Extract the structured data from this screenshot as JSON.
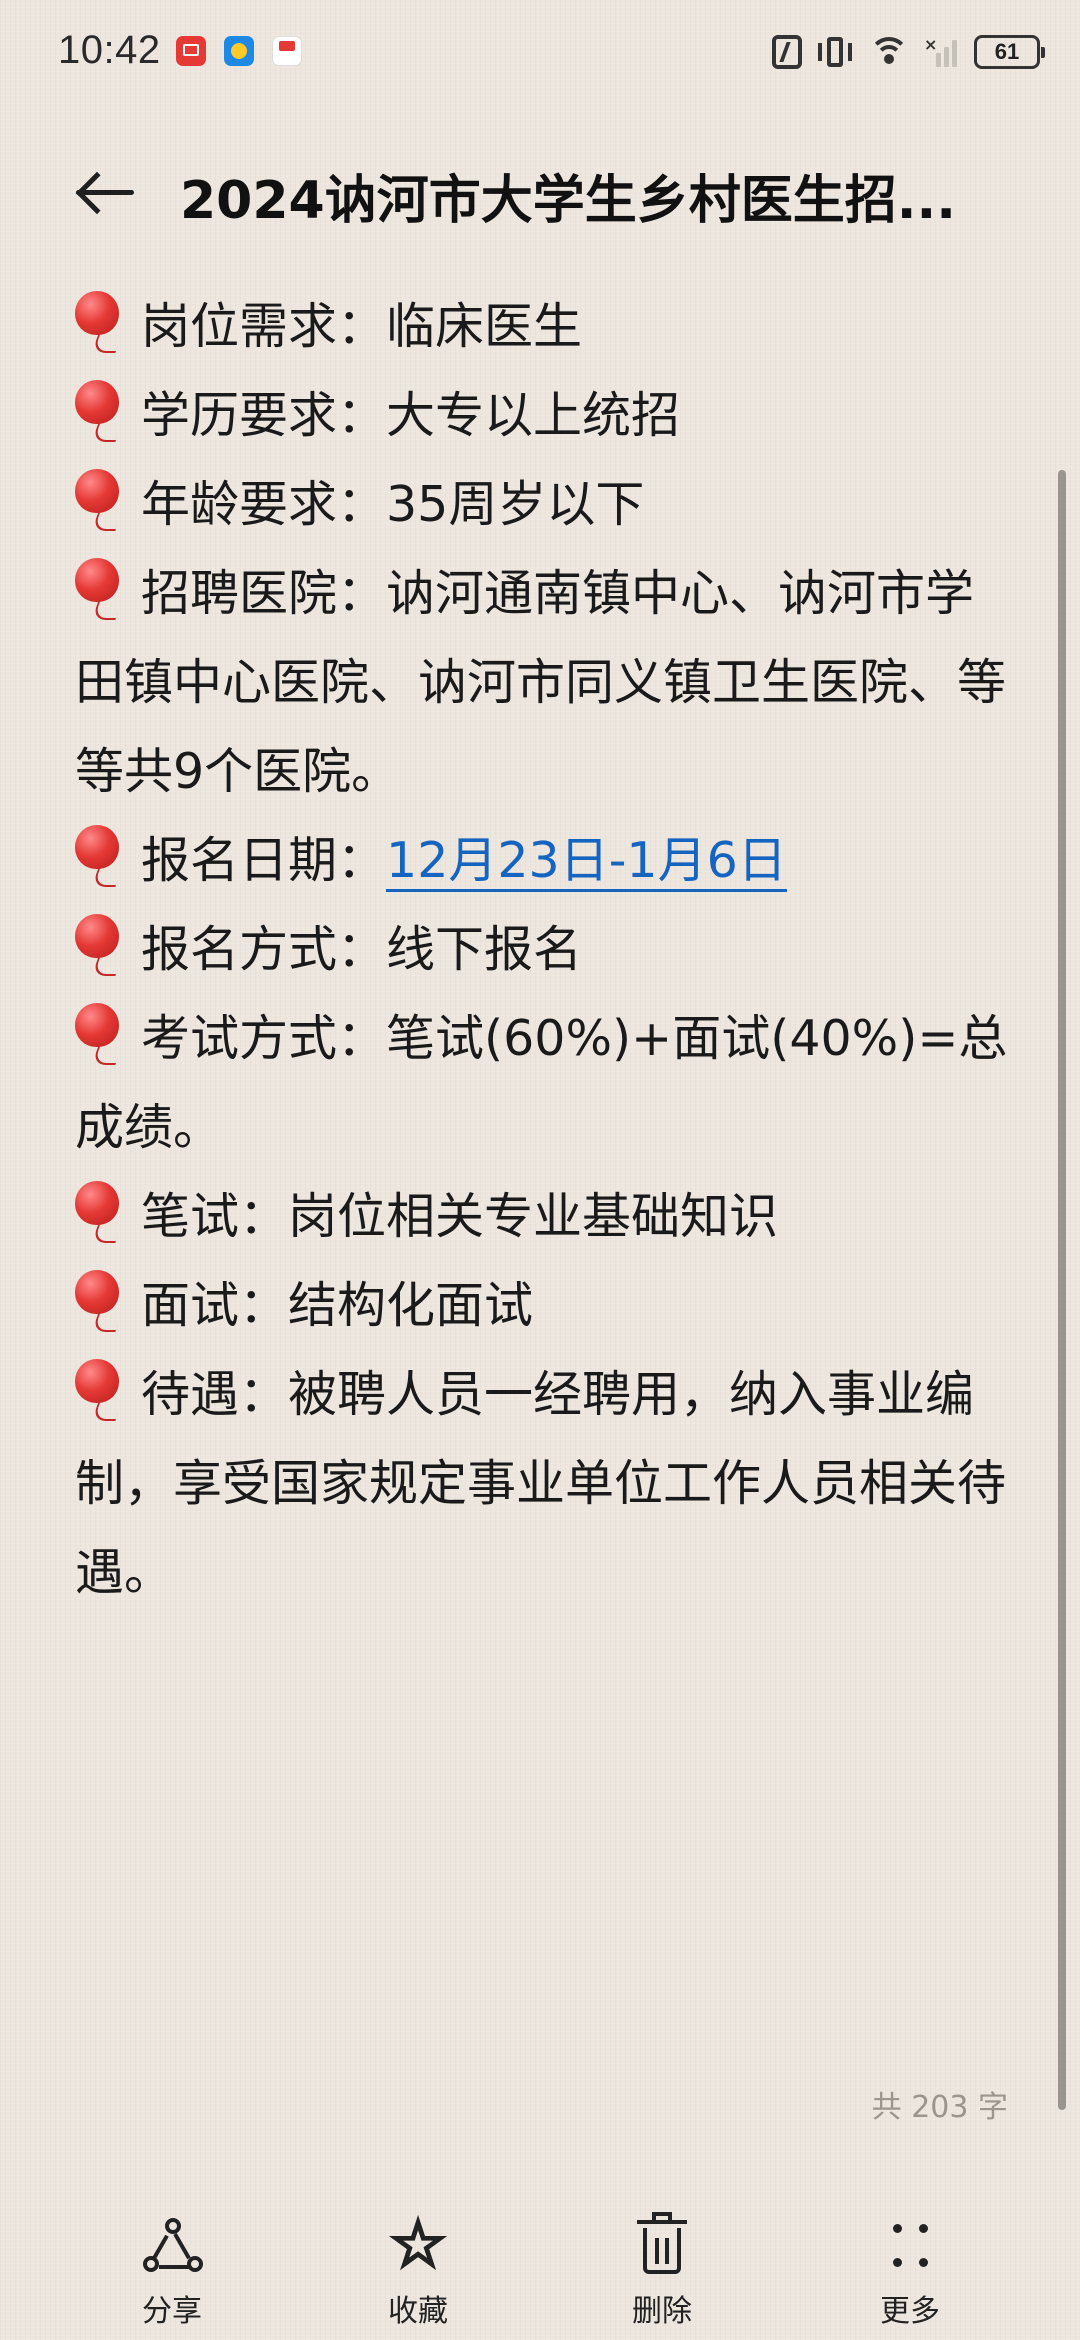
{
  "status_bar": {
    "time": "10:42",
    "battery": "61"
  },
  "header": {
    "title": "2024讷河市大学生乡村医生招..."
  },
  "content": {
    "paragraphs": [
      {
        "has_balloon": true,
        "text": "岗位需求：临床医生"
      },
      {
        "has_balloon": true,
        "text": "学历要求：大专以上统招"
      },
      {
        "has_balloon": true,
        "text": "年龄要求：35周岁以下"
      },
      {
        "has_balloon": true,
        "text": "招聘医院：讷河通南镇中心、讷河市学田镇中心医院、讷河市同义镇卫生医院、等等共9个医院。"
      },
      {
        "has_balloon": true,
        "label": "报名日期：",
        "link": "12月23日-1月6日"
      },
      {
        "has_balloon": true,
        "text": "报名方式：线下报名"
      },
      {
        "has_balloon": true,
        "text": "考试方式：笔试(60%)+面试(40%)=总成绩。"
      },
      {
        "has_balloon": true,
        "text": "笔试：岗位相关专业基础知识"
      },
      {
        "has_balloon": true,
        "text": "面试：结构化面试"
      },
      {
        "has_balloon": true,
        "text": "待遇：被聘人员一经聘用，纳入事业编制，享受国家规定事业单位工作人员相关待遇。"
      }
    ],
    "balloon_icon": "red-balloon-icon",
    "link_color": "#1565c0"
  },
  "word_count": "共 203 字",
  "bottom_bar": {
    "share": "分享",
    "favorite": "收藏",
    "delete": "删除",
    "more": "更多"
  }
}
